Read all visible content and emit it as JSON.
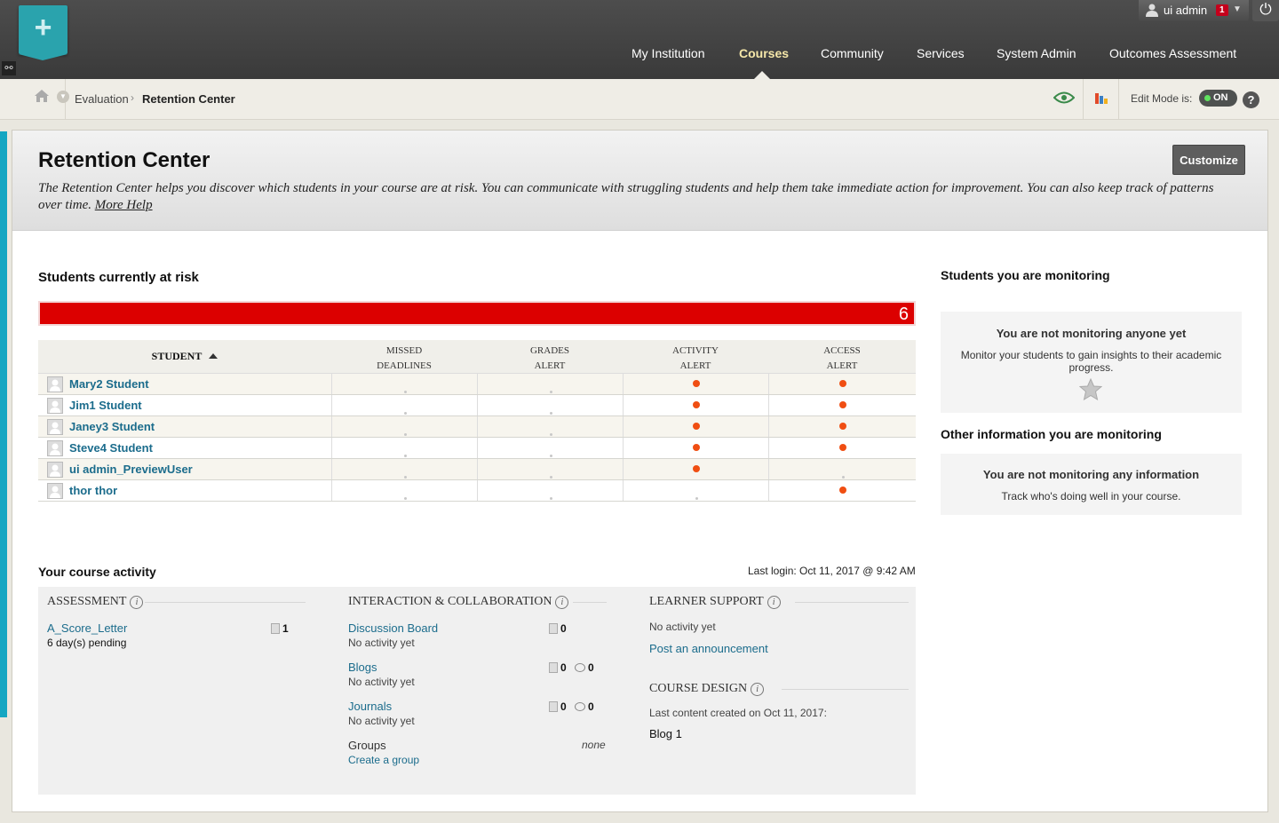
{
  "topbar": {
    "user_name": "ui admin",
    "notification_count": "1",
    "nav": [
      "My Institution",
      "Courses",
      "Community",
      "Services",
      "System Admin",
      "Outcomes Assessment"
    ],
    "active_nav": "Courses",
    "logo_glyph": "+"
  },
  "breadcrumb": {
    "items": [
      "Evaluation",
      "Retention Center"
    ],
    "edit_mode_label": "Edit Mode is:",
    "edit_mode_value": "ON",
    "help_glyph": "?"
  },
  "page": {
    "title": "Retention Center",
    "description": "The Retention Center helps you discover which students in your course are at risk. You can communicate with struggling students and help them take immediate action for improvement. You can also keep track of patterns over time.",
    "help_link": "More Help",
    "customize_label": "Customize"
  },
  "at_risk": {
    "heading": "Students currently at risk",
    "count": "6",
    "columns": {
      "student": "STUDENT",
      "missed_1": "MISSED",
      "missed_2": "DEADLINES",
      "grades_1": "GRADES",
      "grades_2": "ALERT",
      "activity_1": "ACTIVITY",
      "activity_2": "ALERT",
      "access_1": "ACCESS",
      "access_2": "ALERT"
    },
    "rows": [
      {
        "name": "Mary2 Student",
        "missed": false,
        "grades": false,
        "activity": true,
        "access": true
      },
      {
        "name": "Jim1 Student",
        "missed": false,
        "grades": false,
        "activity": true,
        "access": true
      },
      {
        "name": "Janey3 Student",
        "missed": false,
        "grades": false,
        "activity": true,
        "access": true
      },
      {
        "name": "Steve4 Student",
        "missed": false,
        "grades": false,
        "activity": true,
        "access": true
      },
      {
        "name": "ui admin_PreviewUser",
        "missed": false,
        "grades": false,
        "activity": true,
        "access": false
      },
      {
        "name": "thor thor",
        "missed": false,
        "grades": false,
        "activity": false,
        "access": true
      }
    ],
    "alert_color": "#f04e12",
    "bar_color": "#dc0000"
  },
  "activity": {
    "heading": "Your course activity",
    "last_login_label": "Last login:",
    "last_login_value": "Oct 11, 2017 @ 9:42 AM",
    "assessment": {
      "heading": "ASSESSMENT",
      "item_name": "A_Score_Letter",
      "item_status": "6 day(s) pending",
      "item_count": "1"
    },
    "interaction": {
      "heading": "INTERACTION & COLLABORATION",
      "discussion": {
        "name": "Discussion Board",
        "status": "No activity yet",
        "count": "0"
      },
      "blogs": {
        "name": "Blogs",
        "status": "No activity yet",
        "count": "0",
        "comments": "0"
      },
      "journals": {
        "name": "Journals",
        "status": "No activity yet",
        "count": "0",
        "comments": "0"
      },
      "groups": {
        "name": "Groups",
        "value": "none",
        "link": "Create a group"
      }
    },
    "learner_support": {
      "heading": "LEARNER SUPPORT",
      "status": "No activity yet",
      "link": "Post an announcement"
    },
    "course_design": {
      "heading": "COURSE DESIGN",
      "status": "Last content created on Oct 11, 2017:",
      "item": "Blog 1"
    }
  },
  "monitoring": {
    "students_heading": "Students you are monitoring",
    "students_title": "You are not monitoring anyone yet",
    "students_text": "Monitor your students to gain insights to their academic progress.",
    "info_heading": "Other information you are monitoring",
    "info_title": "You are not monitoring any information",
    "info_text": "Track who's doing well in your course."
  }
}
